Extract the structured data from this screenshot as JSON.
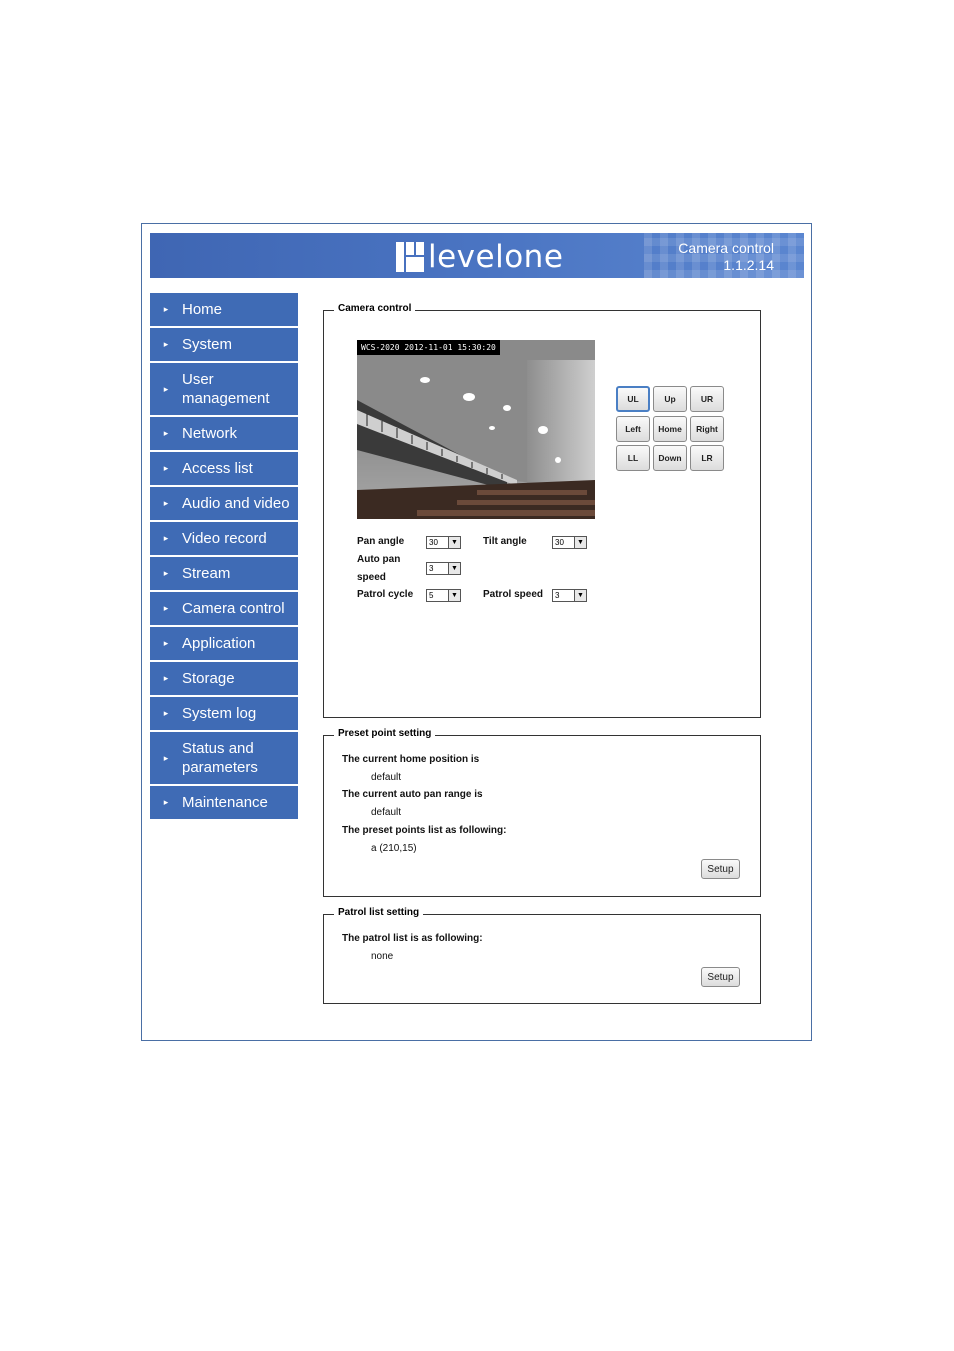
{
  "header": {
    "brand": "levelone",
    "page_title": "Camera control",
    "version": "1.1.2.14"
  },
  "sidebar": {
    "items": [
      {
        "label": "Home"
      },
      {
        "label": "System"
      },
      {
        "label": "User management"
      },
      {
        "label": "Network"
      },
      {
        "label": "Access list"
      },
      {
        "label": "Audio and video"
      },
      {
        "label": "Video record"
      },
      {
        "label": "Stream"
      },
      {
        "label": "Camera control"
      },
      {
        "label": "Application"
      },
      {
        "label": "Storage"
      },
      {
        "label": "System log"
      },
      {
        "label": "Status and parameters"
      },
      {
        "label": "Maintenance"
      }
    ]
  },
  "camera_control": {
    "legend": "Camera control",
    "timestamp": "WCS-2020 2012-11-01 15:30:20",
    "ptz": {
      "ul": "UL",
      "up": "Up",
      "ur": "UR",
      "left": "Left",
      "home": "Home",
      "right": "Right",
      "ll": "LL",
      "down": "Down",
      "lr": "LR"
    },
    "pan_angle": {
      "label": "Pan angle",
      "value": "30"
    },
    "tilt_angle": {
      "label": "Tilt angle",
      "value": "30"
    },
    "auto_pan_speed": {
      "label_1": "Auto pan",
      "label_2": "speed",
      "value": "3"
    },
    "patrol_cycle": {
      "label": "Patrol cycle",
      "value": "5"
    },
    "patrol_speed": {
      "label": "Patrol speed",
      "value": "3"
    }
  },
  "preset": {
    "legend": "Preset point setting",
    "home_label": "The current home position is",
    "home_value": "default",
    "auto_pan_label": "The current auto pan range is",
    "auto_pan_value": "default",
    "list_label": "The preset points list as following:",
    "list_value": "a (210,15)",
    "setup": "Setup"
  },
  "patrol": {
    "legend": "Patrol list setting",
    "list_label": "The patrol list is as following:",
    "list_value": "none",
    "setup": "Setup"
  },
  "colors": {
    "nav_bg": "#3f6bb5",
    "banner_bg": "#4a74c2",
    "active_button_border": "#4a7fc4"
  },
  "icons": {
    "nav_bullet": "triangle-right-icon",
    "select_arrow": "chevron-down-icon"
  }
}
